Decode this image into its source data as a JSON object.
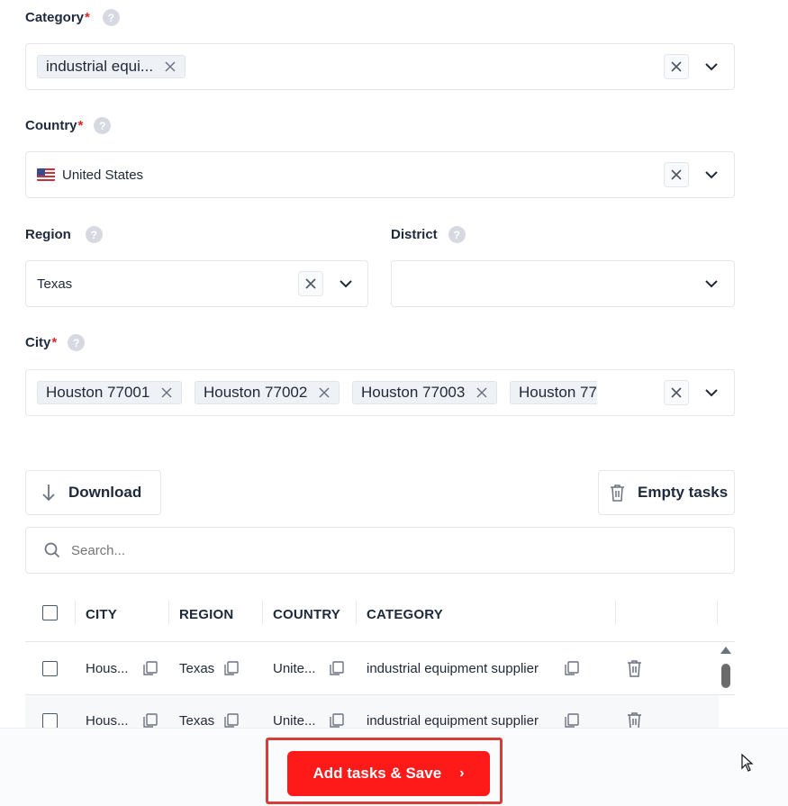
{
  "fields": {
    "category": {
      "label": "Category",
      "required": true,
      "chips": [
        "industrial equi..."
      ]
    },
    "country": {
      "label": "Country",
      "required": true,
      "value": "United States"
    },
    "region": {
      "label": "Region",
      "value": "Texas"
    },
    "district": {
      "label": "District",
      "value": ""
    },
    "city": {
      "label": "City",
      "required": true,
      "chips": [
        "Houston 77001",
        "Houston 77002",
        "Houston 77003",
        "Houston 77"
      ]
    }
  },
  "help_glyph": "?",
  "required_mark": "*",
  "toolbar": {
    "download_label": "Download",
    "empty_label": "Empty tasks"
  },
  "search": {
    "placeholder": "Search..."
  },
  "table": {
    "headers": [
      "CITY",
      "REGION",
      "COUNTRY",
      "CATEGORY"
    ],
    "rows": [
      {
        "city": "Hous...",
        "region": "Texas",
        "country": "Unite...",
        "category": "industrial equipment supplier"
      },
      {
        "city": "Hous...",
        "region": "Texas",
        "country": "Unite...",
        "category": "industrial equipment supplier"
      }
    ]
  },
  "footer": {
    "save_label": "Add tasks & Save",
    "save_arrow": "›"
  },
  "colors": {
    "accent": "#ff1a1a",
    "required": "#dc2626",
    "highlight_frame": "#d93a3a"
  },
  "icons": [
    "help-icon",
    "clear-icon",
    "chevron-down-icon",
    "chip-remove-icon",
    "us-flag-icon",
    "download-arrow-icon",
    "trash-icon",
    "search-icon",
    "copy-icon",
    "scroll-up-icon",
    "mouse-cursor-icon"
  ]
}
